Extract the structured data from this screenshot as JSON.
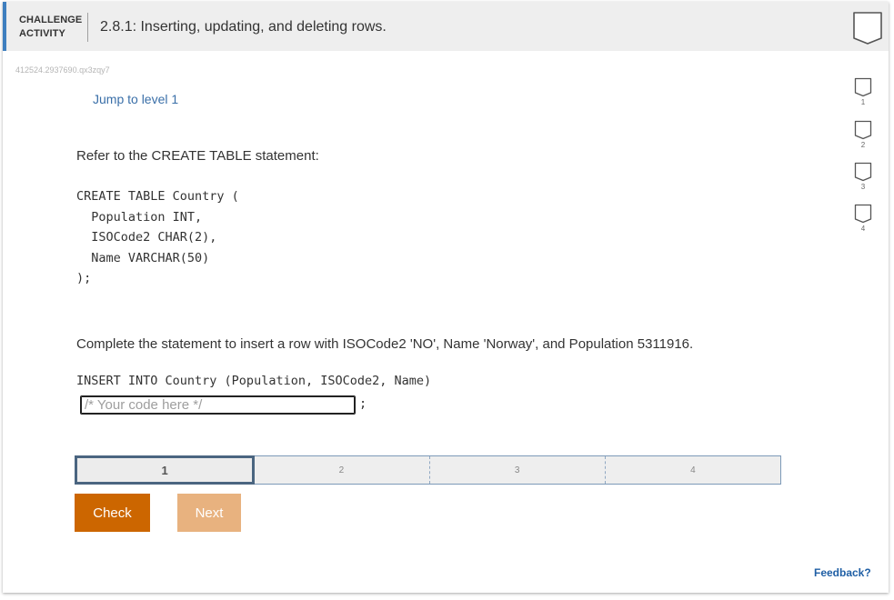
{
  "header": {
    "badge_line1": "CHALLENGE",
    "badge_line2": "ACTIVITY",
    "title": "2.8.1: Inserting, updating, and deleting rows.",
    "accent_color": "#3f7fbf"
  },
  "activity_id": "412524.2937690.qx3zqy7",
  "jump_link": "Jump to level 1",
  "prompt1": "Refer to the CREATE TABLE statement:",
  "create_statement": "CREATE TABLE Country (\n  Population INT,\n  ISOCode2 CHAR(2),\n  Name VARCHAR(50)\n);",
  "prompt2": "Complete the statement to insert a row with ISOCode2 'NO', Name 'Norway', and Population 5311916.",
  "insert_statement": "INSERT INTO Country (Population, ISOCode2, Name)",
  "code_input": {
    "value": "",
    "placeholder": "/* Your code here */"
  },
  "semicolon": ";",
  "levels": [
    {
      "label": "1",
      "active": true
    },
    {
      "label": "2",
      "active": false
    },
    {
      "label": "3",
      "active": false
    },
    {
      "label": "4",
      "active": false
    }
  ],
  "side_levels": [
    "1",
    "2",
    "3",
    "4"
  ],
  "buttons": {
    "check": "Check",
    "next": "Next"
  },
  "feedback": "Feedback?",
  "colors": {
    "check": "#cc6600",
    "next": "#e8b27f",
    "link": "#3a6fa8"
  }
}
